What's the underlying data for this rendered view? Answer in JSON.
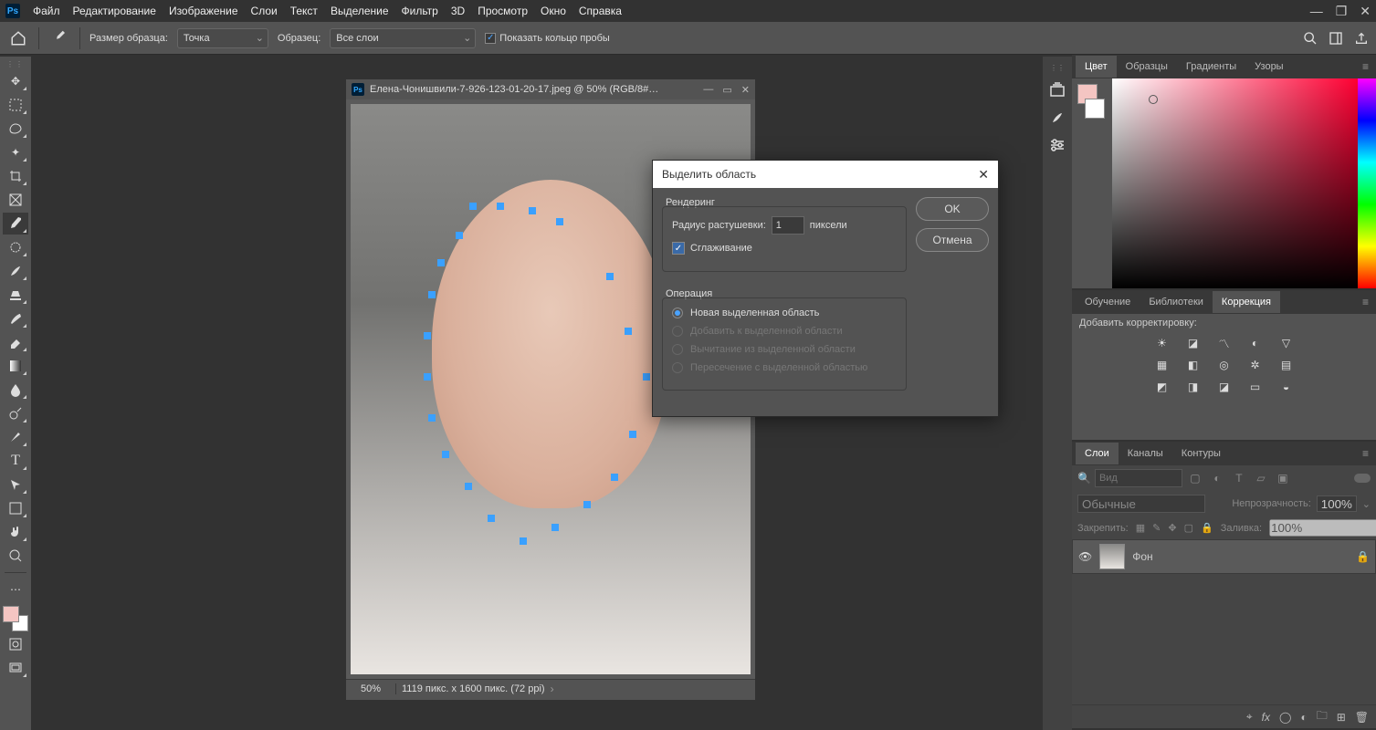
{
  "menubar": {
    "items": [
      "Файл",
      "Редактирование",
      "Изображение",
      "Слои",
      "Текст",
      "Выделение",
      "Фильтр",
      "3D",
      "Просмотр",
      "Окно",
      "Справка"
    ]
  },
  "optbar": {
    "sample_size_label": "Размер образца:",
    "sample_size_value": "Точка",
    "sample_label": "Образец:",
    "sample_value": "Все слои",
    "show_ring": "Показать кольцо пробы"
  },
  "document": {
    "title": "Елена-Чонишвили-7-926-123-01-20-17.jpeg @ 50% (RGB/8#…",
    "zoom": "50%",
    "info": "1119 пикс. x 1600 пикс. (72 ppi)"
  },
  "dialog": {
    "title": "Выделить область",
    "ok": "OK",
    "cancel": "Отмена",
    "render_legend": "Рендеринг",
    "feather_label": "Радиус растушевки:",
    "feather_value": "1",
    "feather_unit": "пиксели",
    "antialias": "Сглаживание",
    "operation_legend": "Операция",
    "op_new": "Новая выделенная область",
    "op_add": "Добавить к выделенной области",
    "op_sub": "Вычитание из выделенной области",
    "op_int": "Пересечение с выделенной областью"
  },
  "panels": {
    "color_tabs": [
      "Цвет",
      "Образцы",
      "Градиенты",
      "Узоры"
    ],
    "adjust_tabs": [
      "Обучение",
      "Библиотеки",
      "Коррекция"
    ],
    "adjust_hint": "Добавить корректировку:",
    "layers_tabs": [
      "Слои",
      "Каналы",
      "Контуры"
    ],
    "layer_search_placeholder": "Вид",
    "blend_mode": "Обычные",
    "opacity_label": "Непрозрачность:",
    "opacity_value": "100%",
    "lock_label": "Закрепить:",
    "fill_label": "Заливка:",
    "fill_value": "100%",
    "bg_layer": "Фон"
  }
}
